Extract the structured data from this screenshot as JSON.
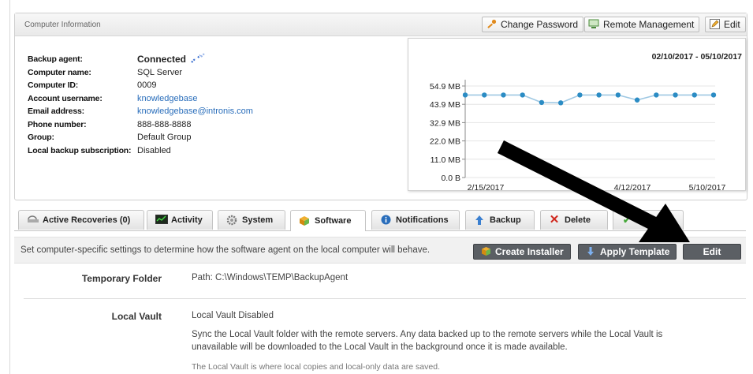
{
  "card": {
    "title": "Computer Information",
    "buttons": {
      "change_password": "Change Password",
      "remote_management": "Remote Management",
      "edit": "Edit"
    },
    "info": [
      {
        "label": "Backup agent:",
        "value": "Connected",
        "kind": "connected"
      },
      {
        "label": "Computer name:",
        "value": "SQL Server",
        "kind": "text"
      },
      {
        "label": "Computer ID:",
        "value": "0009",
        "kind": "text"
      },
      {
        "label": "Account username:",
        "value": "knowledgebase",
        "kind": "link"
      },
      {
        "label": "Email address:",
        "value": "knowledgebase@intronis.com",
        "kind": "link"
      },
      {
        "label": "Phone number:",
        "value": "888-888-8888",
        "kind": "text"
      },
      {
        "label": "Group:",
        "value": "Default Group",
        "kind": "text"
      },
      {
        "label": "Local backup subscription:",
        "value": "Disabled",
        "kind": "text"
      }
    ]
  },
  "chart_data": {
    "type": "line",
    "title": "",
    "date_range": "02/10/2017 - 05/10/2017",
    "y_ticks": [
      "0.0 B",
      "11.0 MB",
      "22.0 MB",
      "32.9 MB",
      "43.9 MB",
      "54.9 MB"
    ],
    "x_ticks": [
      "2/15/2017",
      "4/12/2017",
      "5/10/2017"
    ],
    "ylim": [
      0,
      54.9
    ],
    "series": [
      {
        "values": [
          49.5,
          49.5,
          49.5,
          49.5,
          45.0,
          44.8,
          49.5,
          49.5,
          49.5,
          46.5,
          49.5,
          49.5,
          49.5,
          49.5
        ]
      }
    ],
    "color": "#2b8cc4"
  },
  "tabs": [
    {
      "label": "Active Recoveries (0)",
      "icon": "recoveries-icon"
    },
    {
      "label": "Activity",
      "icon": "activity-icon"
    },
    {
      "label": "System",
      "icon": "gear-icon"
    },
    {
      "label": "Software",
      "icon": "software-icon"
    },
    {
      "label": "Notifications",
      "icon": "info-icon"
    },
    {
      "label": "Backup",
      "icon": "up-arrow-icon"
    },
    {
      "label": "Delete",
      "icon": "delete-icon"
    }
  ],
  "software": {
    "description": "Set computer-specific settings to determine how the software agent on the local computer will behave.",
    "create_installer": "Create Installer",
    "apply_template": "Apply Template",
    "edit": "Edit",
    "temp_folder_label": "Temporary Folder",
    "temp_folder_value": "Path: C:\\Windows\\TEMP\\BackupAgent",
    "local_vault_label": "Local Vault",
    "local_vault_status": "Local Vault Disabled",
    "local_vault_desc_1": "Sync the Local Vault folder with the remote servers. Any data backed up to the remote servers while the Local Vault is",
    "local_vault_desc_2": "unavailable will be downloaded to the Local Vault in the background once it is made available.",
    "local_vault_note": "The Local Vault is where local copies and local-only data are saved."
  }
}
